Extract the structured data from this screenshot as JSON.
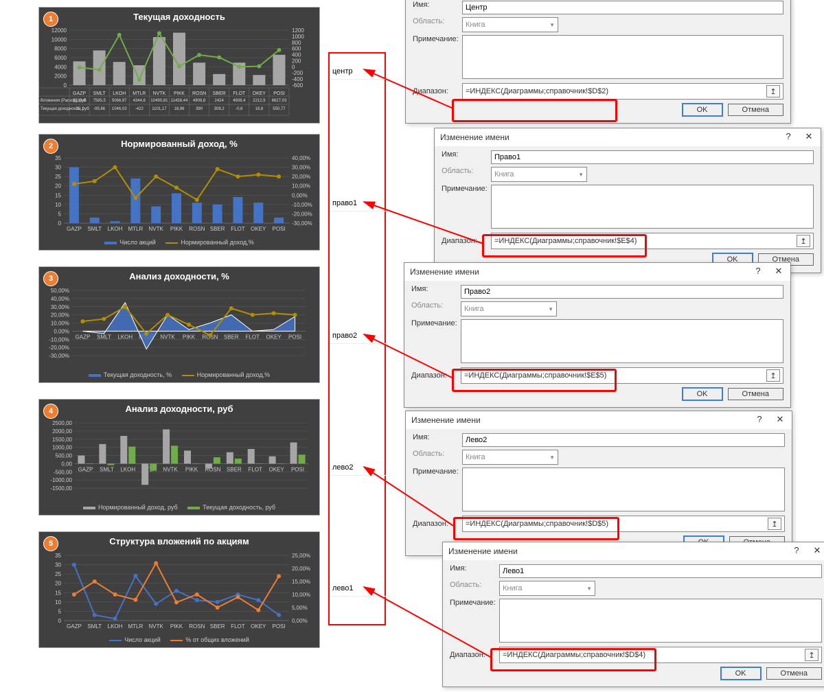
{
  "list": {
    "center": "центр",
    "pravo1": "право1",
    "pravo2": "право2",
    "levo2": "лево2",
    "levo1": "лево1"
  },
  "dialogs": {
    "title": "Изменение имени",
    "name_lbl": "Имя:",
    "name_u": "И",
    "scope_lbl": "Область:",
    "scope_val": "Книга",
    "note_lbl": "Примечание:",
    "note_u": "П",
    "range_lbl": "Диапазон:",
    "range_u": "з",
    "ok": "OK",
    "cancel": "Отмена",
    "entries": [
      {
        "id": "d1",
        "name": "Центр",
        "range": "=ИНДЕКС(Диаграммы;справочник!$D$2)"
      },
      {
        "id": "d2",
        "name": "Право1",
        "range": "=ИНДЕКС(Диаграммы;справочник!$E$4)"
      },
      {
        "id": "d3",
        "name": "Право2",
        "range": "=ИНДЕКС(Диаграммы;справочник!$E$5)"
      },
      {
        "id": "d4",
        "name": "Лево2",
        "range": "=ИНДЕКС(Диаграммы;справочник!$D$5)"
      },
      {
        "id": "d5",
        "name": "Лево1",
        "range": "=ИНДЕКС(Диаграммы;справочник!$D$4)"
      }
    ]
  },
  "chart_data": [
    {
      "id": "c1",
      "title": "Текущая доходность",
      "type": "bar+line",
      "badge": "1",
      "categories": [
        "GAZP",
        "SMLT",
        "LKOH",
        "MTLR",
        "NVTK",
        "PIKK",
        "ROSN",
        "SBER",
        "FLOT",
        "OKEY",
        "POSI"
      ],
      "series": [
        {
          "name": "Вложения (Расход), руб",
          "kind": "bar",
          "color": "#A6A6A6",
          "axis": "left",
          "values": [
            5193.6,
            7585.5,
            5066.97,
            4344.6,
            10490.81,
            11458.44,
            4909.8,
            2424,
            4908.4,
            2212.9,
            6627.03
          ]
        },
        {
          "name": "Текущая доходность, руб",
          "kind": "line",
          "color": "#70AD47",
          "axis": "right",
          "values": [
            -20.1,
            -95.66,
            1046.03,
            -422,
            1101.17,
            18.96,
            390,
            308.2,
            -0.6,
            18.8,
            550.77
          ]
        }
      ],
      "left_axis": {
        "ticks": [
          0,
          2000,
          4000,
          6000,
          8000,
          10000,
          12000
        ]
      },
      "right_axis": {
        "ticks": [
          -600,
          -400,
          -200,
          0,
          200,
          400,
          600,
          800,
          1000,
          1200
        ]
      },
      "legend_kind": "table"
    },
    {
      "id": "c2",
      "title": "Нормированный доход, %",
      "type": "bar+line",
      "badge": "2",
      "categories": [
        "GAZP",
        "SMLT",
        "LKOH",
        "MTLR",
        "NVTK",
        "PIKK",
        "ROSN",
        "SBER",
        "FLOT",
        "OKEY",
        "POSI"
      ],
      "series": [
        {
          "name": "Число акций",
          "kind": "bar",
          "color": "#4472C4",
          "axis": "left",
          "values": [
            30,
            3,
            1,
            24,
            9,
            16,
            11,
            10,
            14,
            11,
            3
          ]
        },
        {
          "name": "Нормированный доход,%",
          "kind": "line",
          "color": "#B28F00",
          "axis": "right",
          "values": [
            12,
            15,
            30,
            -3,
            20,
            8,
            -5,
            28,
            20,
            22,
            20
          ]
        }
      ],
      "left_axis": {
        "ticks": [
          0,
          5,
          10,
          15,
          20,
          25,
          30,
          35
        ]
      },
      "right_axis": {
        "ticks": [
          -30,
          -20,
          -10,
          0,
          10,
          20,
          30,
          40
        ],
        "suffix": "%",
        "fmt": "0,00%"
      }
    },
    {
      "id": "c3",
      "title": "Анализ доходности, %",
      "type": "area+line",
      "badge": "3",
      "categories": [
        "GAZP",
        "SMLT",
        "LKOH",
        "MTLR",
        "NVTK",
        "PIKK",
        "ROSN",
        "SBER",
        "FLOT",
        "OKEY",
        "POSI"
      ],
      "series": [
        {
          "name": "Текущая доходность, %",
          "kind": "area",
          "color": "#4472C4",
          "values": [
            0,
            -3,
            35,
            -22,
            20,
            2,
            10,
            20,
            0,
            2,
            18
          ]
        },
        {
          "name": "Нормированный доход,%",
          "kind": "line",
          "color": "#B28F00",
          "values": [
            12,
            15,
            30,
            -3,
            20,
            8,
            -5,
            28,
            20,
            22,
            20
          ]
        }
      ],
      "left_axis": {
        "ticks": [
          -30,
          -20,
          -10,
          0,
          10,
          20,
          30,
          40,
          50
        ],
        "suffix": "%",
        "fmt": "0,00%"
      }
    },
    {
      "id": "c4",
      "title": "Анализ доходности, руб",
      "type": "bar",
      "badge": "4",
      "categories": [
        "GAZP",
        "SMLT",
        "LKOH",
        "MTLR",
        "NVTK",
        "PIKK",
        "ROSN",
        "SBER",
        "FLOT",
        "OKEY",
        "POSI"
      ],
      "series": [
        {
          "name": "Нормированный доход, руб",
          "color": "#A6A6A6",
          "values": [
            500,
            1200,
            1700,
            -1300,
            2100,
            800,
            -300,
            700,
            900,
            450,
            1300
          ]
        },
        {
          "name": "Текущая доходность, руб",
          "color": "#70AD47",
          "values": [
            -20,
            -95,
            1046,
            -422,
            1101,
            19,
            390,
            308,
            -1,
            19,
            551
          ]
        }
      ],
      "left_axis": {
        "ticks": [
          -1500,
          -1000,
          -500,
          0,
          500,
          1000,
          1500,
          2000,
          2500
        ],
        "fmt": "0,00"
      }
    },
    {
      "id": "c5",
      "title": "Структура вложений по акциям",
      "type": "line",
      "badge": "5",
      "categories": [
        "GAZP",
        "SMLT",
        "LKOH",
        "MTLR",
        "NVTK",
        "PIKK",
        "ROSN",
        "SBER",
        "FLOT",
        "OKEY",
        "POSI"
      ],
      "series": [
        {
          "name": "Число акций",
          "color": "#4472C4",
          "axis": "left",
          "values": [
            30,
            3,
            1,
            24,
            9,
            16,
            11,
            10,
            14,
            11,
            3
          ]
        },
        {
          "name": "% от общих вложений",
          "color": "#ED7D31",
          "axis": "right",
          "values": [
            10,
            15,
            10,
            8,
            22,
            7,
            10,
            5,
            9,
            4,
            17
          ]
        }
      ],
      "left_axis": {
        "ticks": [
          0,
          5,
          10,
          15,
          20,
          25,
          30,
          35
        ]
      },
      "right_axis": {
        "ticks": [
          0,
          5,
          10,
          15,
          20,
          25
        ],
        "suffix": "%",
        "fmt": "0,00%"
      }
    }
  ]
}
